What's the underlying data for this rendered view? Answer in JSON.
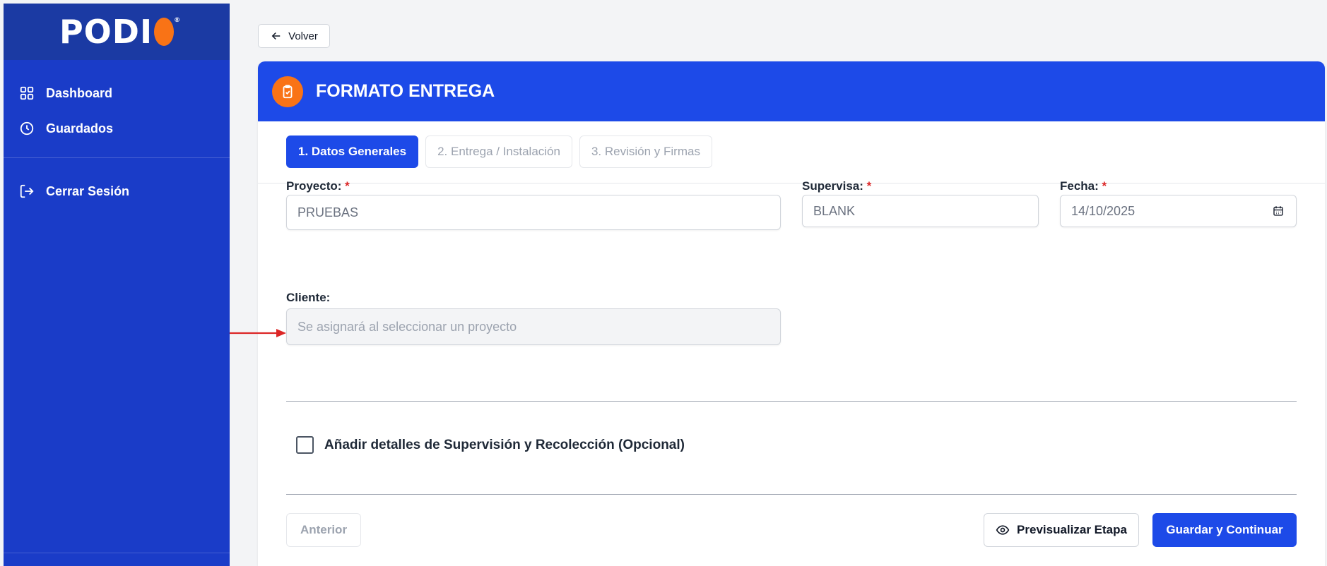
{
  "app": {
    "logo_text": "PODI",
    "logo_trademark": "®"
  },
  "sidebar": {
    "items": [
      {
        "label": "Dashboard",
        "icon": "grid-icon"
      },
      {
        "label": "Guardados",
        "icon": "clock-icon"
      },
      {
        "label": "Cerrar Sesión",
        "icon": "logout-icon"
      }
    ]
  },
  "back_button": {
    "label": "Volver",
    "icon": "arrow-left-icon"
  },
  "form": {
    "title": "FORMATO ENTREGA",
    "header_icon": "clipboard-check-icon",
    "tabs": [
      {
        "label": "1. Datos Generales",
        "active": true
      },
      {
        "label": "2. Entrega / Instalación",
        "active": false
      },
      {
        "label": "3. Revisión y Firmas",
        "active": false
      }
    ],
    "fields": {
      "proyecto": {
        "label": "Proyecto:",
        "required_mark": "*",
        "value": "PRUEBAS"
      },
      "supervisa": {
        "label": "Supervisa:",
        "required_mark": "*",
        "value": "BLANK"
      },
      "fecha": {
        "label": "Fecha:",
        "required_mark": "*",
        "value": "14/10/2025",
        "icon": "calendar-icon"
      },
      "cliente": {
        "label": "Cliente:",
        "placeholder": "Se asignará al seleccionar un proyecto"
      }
    },
    "optional_checkbox": {
      "label": "Añadir detalles de Supervisión y Recolección (Opcional)",
      "checked": false
    },
    "buttons": {
      "prev": "Anterior",
      "preview": "Previsualizar Etapa",
      "save": "Guardar y Continuar"
    }
  },
  "colors": {
    "sidebar": "#1a3cc8",
    "primary": "#1d4ae8",
    "accent": "#f97316",
    "annotation_arrow": "#dc2626"
  }
}
